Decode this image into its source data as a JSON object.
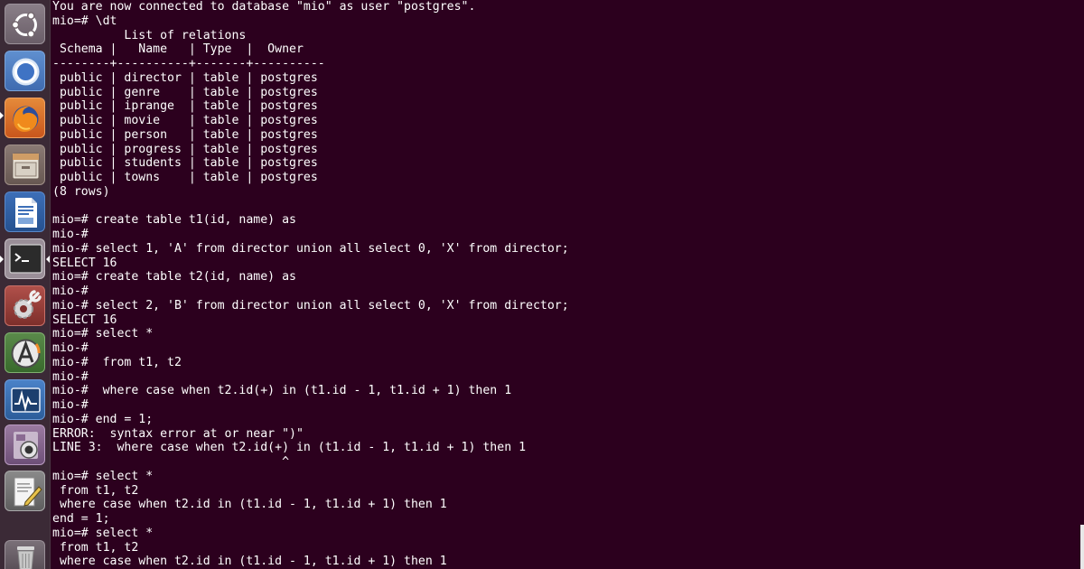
{
  "launcher": {
    "items": [
      {
        "name": "dash-home",
        "icon": "ubuntu-logo-icon",
        "running": false,
        "active": false
      },
      {
        "name": "chromium",
        "icon": "chromium-icon",
        "running": false,
        "active": false
      },
      {
        "name": "firefox",
        "icon": "firefox-icon",
        "running": true,
        "active": false
      },
      {
        "name": "files",
        "icon": "file-cabinet-icon",
        "running": false,
        "active": false
      },
      {
        "name": "libreoffice-writer",
        "icon": "writer-document-icon",
        "running": false,
        "active": false
      },
      {
        "name": "terminal",
        "icon": "terminal-icon",
        "running": true,
        "active": true
      },
      {
        "name": "system-settings",
        "icon": "wrench-gear-icon",
        "running": false,
        "active": false
      },
      {
        "name": "software-updater",
        "icon": "software-updater-icon",
        "running": false,
        "active": false
      },
      {
        "name": "system-monitor",
        "icon": "system-monitor-icon",
        "running": false,
        "active": false
      },
      {
        "name": "cheese",
        "icon": "webcam-icon",
        "running": false,
        "active": false
      },
      {
        "name": "text-editor",
        "icon": "text-editor-icon",
        "running": false,
        "active": false
      },
      {
        "name": "trash",
        "icon": "trash-icon",
        "running": false,
        "active": false
      }
    ]
  },
  "terminal": {
    "background_color": "#2c001e",
    "text_color": "#ffffff",
    "lines": [
      "You are now connected to database \"mio\" as user \"postgres\".",
      "mio=# \\dt",
      "          List of relations",
      " Schema |   Name   | Type  |  Owner",
      "--------+----------+-------+----------",
      " public | director | table | postgres",
      " public | genre    | table | postgres",
      " public | iprange  | table | postgres",
      " public | movie    | table | postgres",
      " public | person   | table | postgres",
      " public | progress | table | postgres",
      " public | students | table | postgres",
      " public | towns    | table | postgres",
      "(8 rows)",
      "",
      "mio=# create table t1(id, name) as",
      "mio-#",
      "mio-# select 1, 'A' from director union all select 0, 'X' from director;",
      "SELECT 16",
      "mio=# create table t2(id, name) as",
      "mio-#",
      "mio-# select 2, 'B' from director union all select 0, 'X' from director;",
      "SELECT 16",
      "mio=# select *",
      "mio-#",
      "mio-#  from t1, t2",
      "mio-#",
      "mio-#  where case when t2.id(+) in (t1.id - 1, t1.id + 1) then 1",
      "mio-#",
      "mio-# end = 1;",
      "ERROR:  syntax error at or near \")\"",
      "LINE 3:  where case when t2.id(+) in (t1.id - 1, t1.id + 1) then 1",
      "                                ^",
      "mio=# select *",
      " from t1, t2",
      " where case when t2.id in (t1.id - 1, t1.id + 1) then 1",
      "end = 1;",
      "mio=# select *",
      " from t1, t2",
      " where case when t2.id in (t1.id - 1, t1.id + 1) then 1"
    ]
  }
}
